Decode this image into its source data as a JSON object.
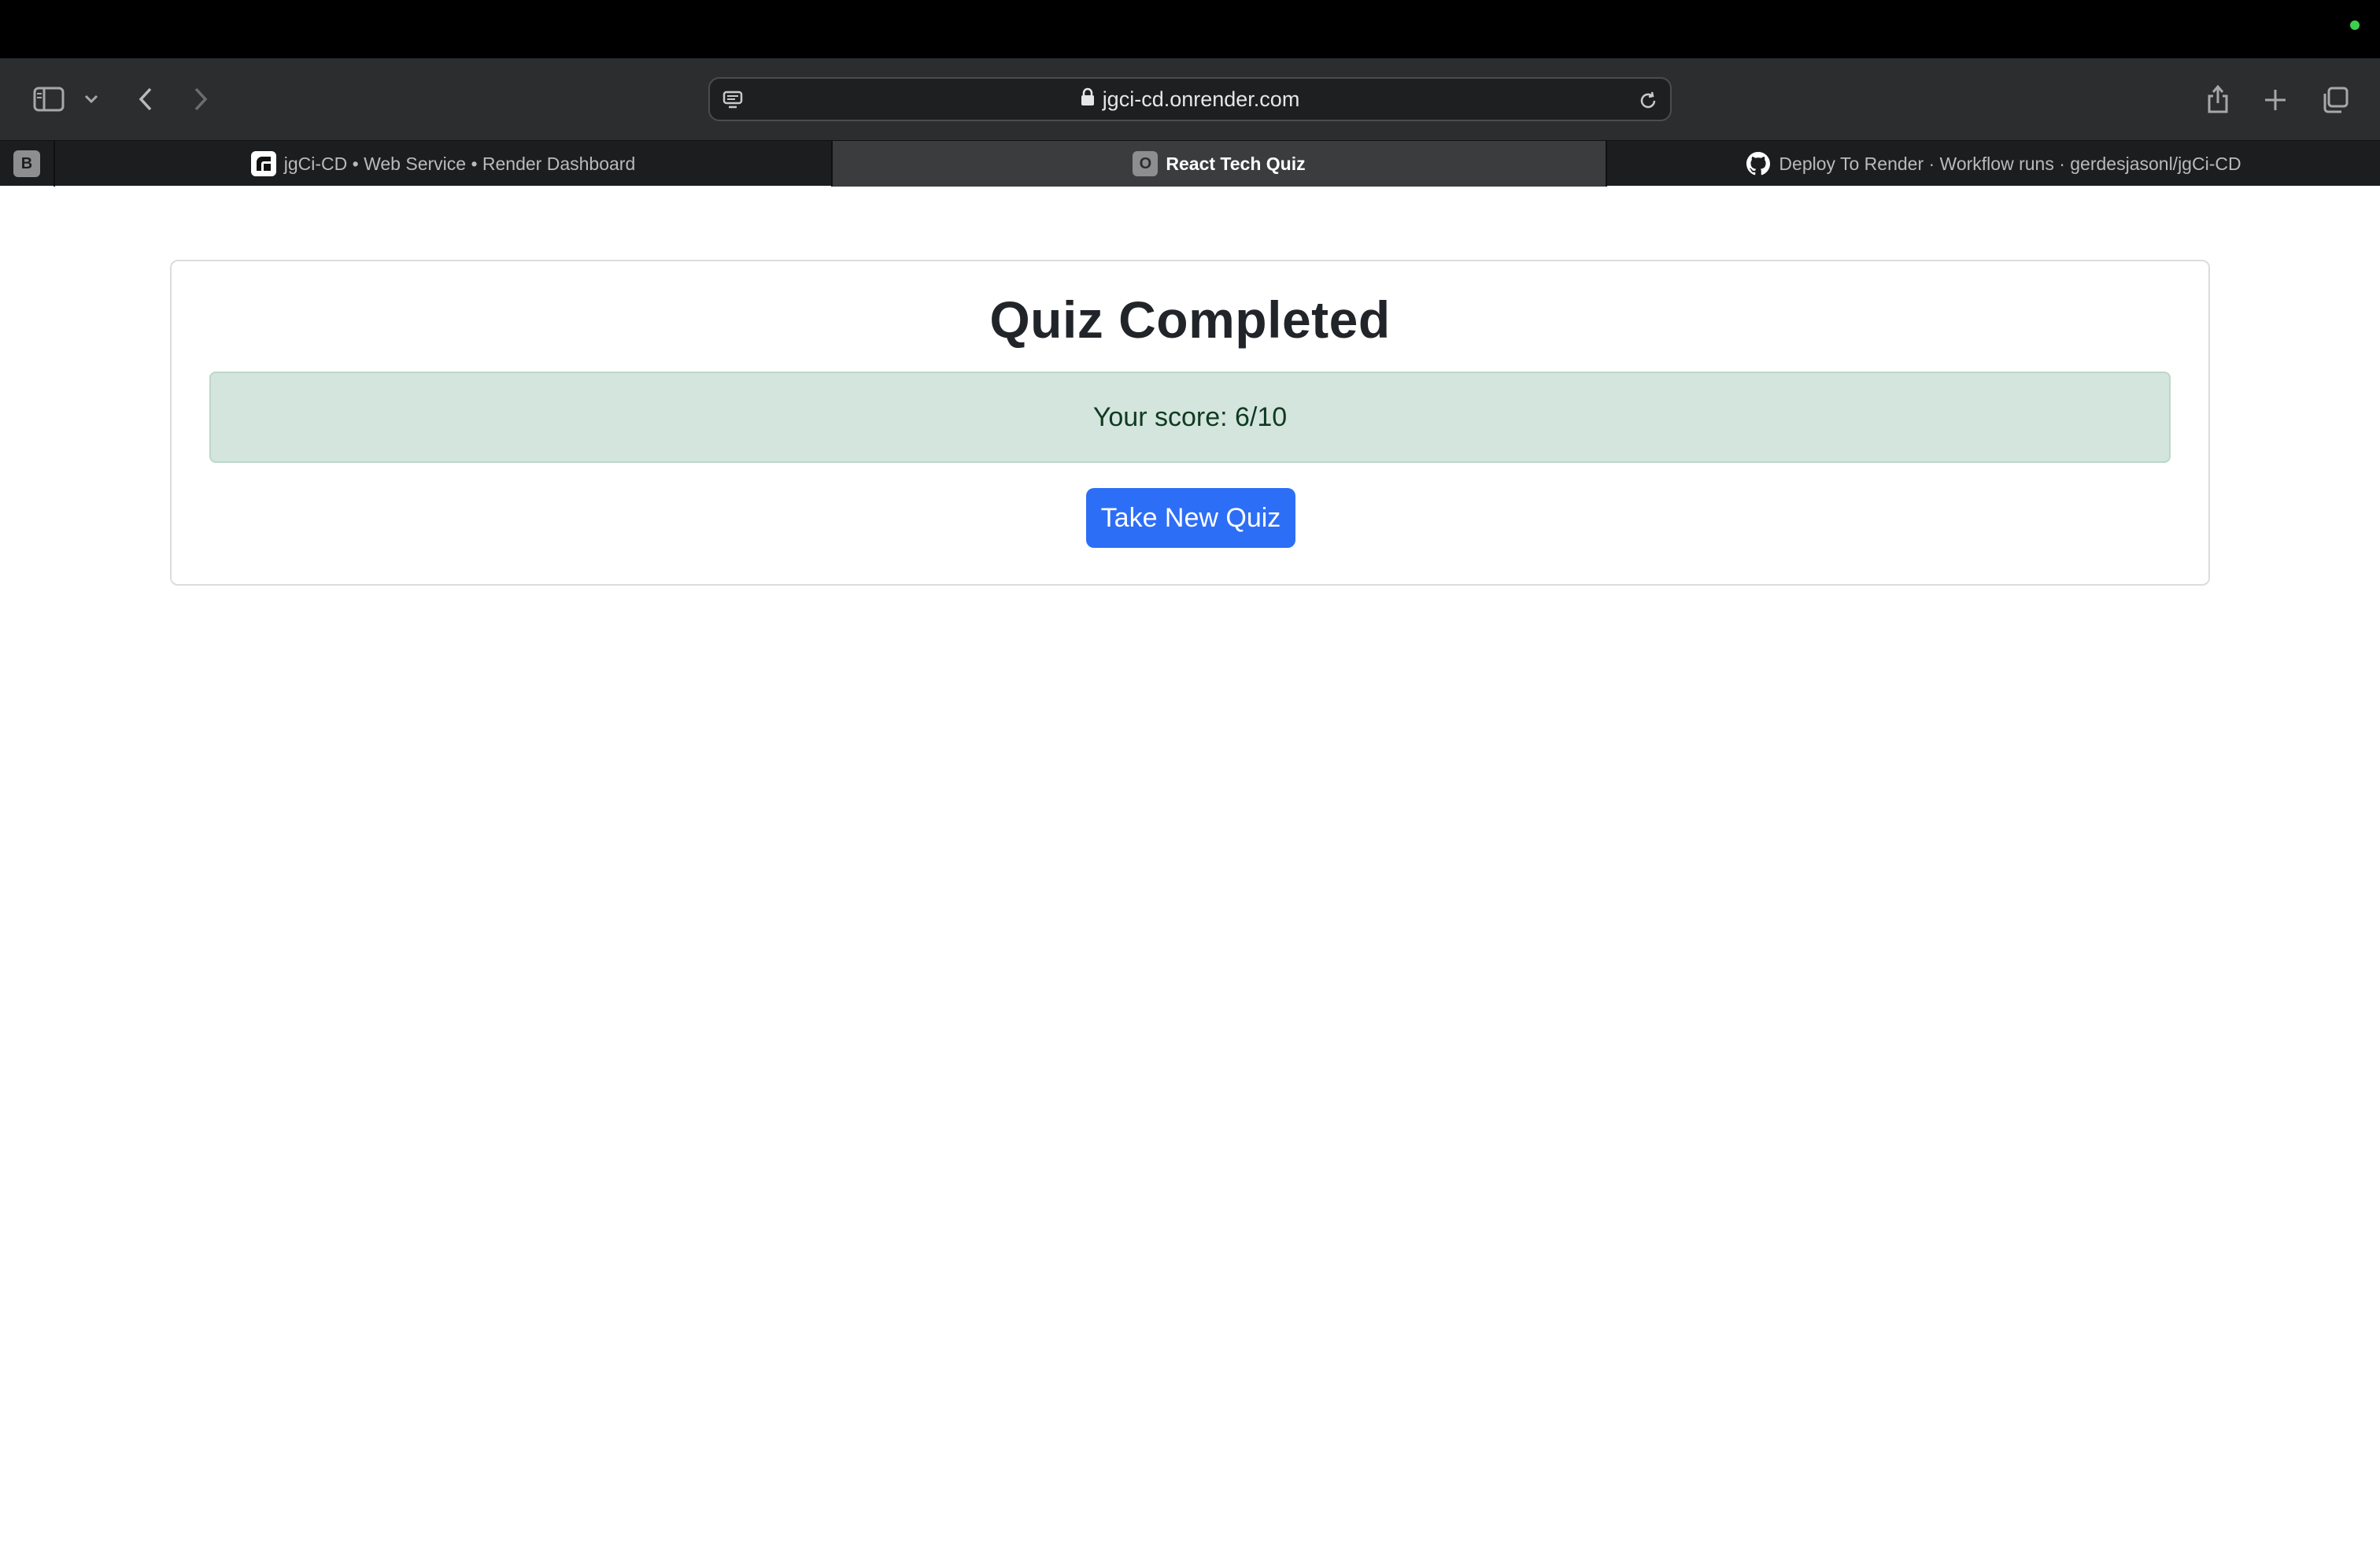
{
  "browser": {
    "url": "jgci-cd.onrender.com",
    "tabs": [
      {
        "label": "jgCi-CD  •  Web Service  •  Render Dashboard",
        "active": false,
        "favicon": "render-icon"
      },
      {
        "label": "React Tech Quiz",
        "active": true,
        "favicon_letter": "O"
      },
      {
        "label": "Deploy To Render · Workflow runs · gerdesjasonl/jgCi-CD",
        "active": false,
        "favicon": "github-icon"
      }
    ],
    "pinned_tab_letter": "B"
  },
  "quiz": {
    "title": "Quiz Completed",
    "score_text": "Your score: 6/10",
    "button_label": "Take New Quiz"
  },
  "colors": {
    "accent": "#2d6ef6",
    "score_bg": "#d4e5dd",
    "toolbar_bg": "#2b2d2e"
  }
}
